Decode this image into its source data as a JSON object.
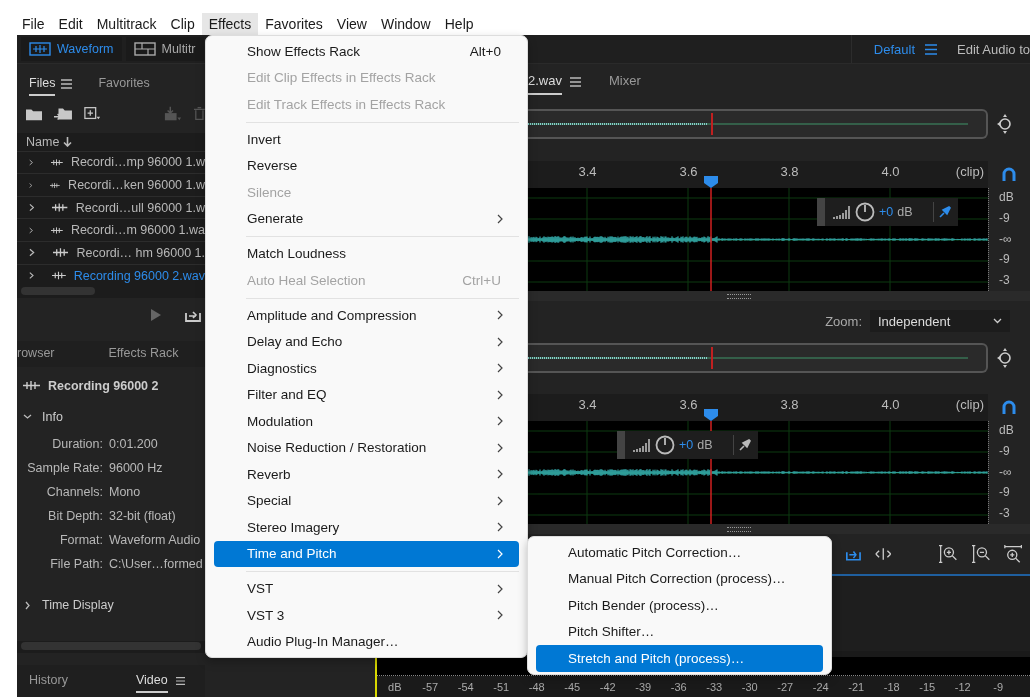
{
  "menu_bar": [
    {
      "label": "File",
      "selected": false
    },
    {
      "label": "Edit",
      "selected": false
    },
    {
      "label": "Multitrack",
      "selected": false
    },
    {
      "label": "Clip",
      "selected": false
    },
    {
      "label": "Effects",
      "selected": true
    },
    {
      "label": "Favorites",
      "selected": false
    },
    {
      "label": "View",
      "selected": false
    },
    {
      "label": "Window",
      "selected": false
    },
    {
      "label": "Help",
      "selected": false
    }
  ],
  "toolbar": {
    "modes": [
      {
        "label": "Waveform",
        "selected": true
      },
      {
        "label": "Multitr",
        "selected": false
      }
    ],
    "workspace": "Default",
    "next_workspace": "Edit Audio to"
  },
  "files_panel": {
    "tabs": [
      {
        "label": "Files",
        "selected": true
      },
      {
        "label": "Favorites",
        "selected": false
      }
    ],
    "column": "Name",
    "files": [
      {
        "name": "Recordi…mp 96000 1.w",
        "selected": false
      },
      {
        "name": "Recordi…ken 96000 1.w",
        "selected": false
      },
      {
        "name": "Recordi…ull 96000 1.w",
        "selected": false
      },
      {
        "name": "Recordi…m 96000 1.wa",
        "selected": false
      },
      {
        "name": "Recordi… hm 96000 1.",
        "selected": false
      },
      {
        "name": "Recording 96000 2.wav",
        "selected": true
      }
    ]
  },
  "properties_panel": {
    "tabs": [
      {
        "label": "rowser",
        "selected": false
      },
      {
        "label": "Effects Rack",
        "selected": false
      }
    ],
    "file": "Recording 96000 2",
    "sections": [
      {
        "title": "Info",
        "expanded": true,
        "rows": [
          {
            "label": "Duration:",
            "value": "0:01.200"
          },
          {
            "label": "Sample Rate:",
            "value": "96000 Hz"
          },
          {
            "label": "Channels:",
            "value": "Mono"
          },
          {
            "label": "Bit Depth:",
            "value": "32-bit (float)"
          },
          {
            "label": "Format:",
            "value": "Waveform Audio"
          },
          {
            "label": "File Path:",
            "value": "C:\\User…formed"
          }
        ]
      },
      {
        "title": "Time Display",
        "expanded": false
      }
    ]
  },
  "bottom_tabs": [
    {
      "label": "History",
      "selected": false
    },
    {
      "label": "Video",
      "selected": true
    }
  ],
  "editor": {
    "tabs": [
      {
        "label": "2.wav",
        "selected": true
      },
      {
        "label": "Mixer",
        "selected": false
      }
    ],
    "zoom_label": "Zoom:",
    "zoom_value": "Independent",
    "tracks": [
      {
        "ruler": [
          "3.4",
          "3.6",
          "3.8",
          "4.0"
        ],
        "ruler_end": "(clip)",
        "gain": "+0",
        "gain_unit": "dB",
        "scale": [
          "dB",
          "-9",
          "-∞",
          "-9",
          "-3"
        ]
      },
      {
        "ruler": [
          "3.4",
          "3.6",
          "3.8",
          "4.0"
        ],
        "ruler_end": "(clip)",
        "gain": "+0",
        "gain_unit": "dB",
        "scale": [
          "dB",
          "-9",
          "-∞",
          "-9",
          "-3"
        ]
      }
    ]
  },
  "meter": {
    "labels": [
      "dB",
      "-57",
      "-54",
      "-51",
      "-48",
      "-45",
      "-42",
      "-39",
      "-36",
      "-33",
      "-30",
      "-27",
      "-24",
      "-21",
      "-18",
      "-15",
      "-12",
      "-9"
    ]
  },
  "effects_menu": [
    {
      "kind": "item",
      "label": "Show Effects Rack",
      "shortcut": "Alt+0",
      "disabled": false,
      "submenu": false,
      "selected": false
    },
    {
      "kind": "item",
      "label": "Edit Clip Effects in Effects Rack",
      "disabled": true,
      "submenu": false,
      "selected": false
    },
    {
      "kind": "item",
      "label": "Edit Track Effects in Effects Rack",
      "disabled": true,
      "submenu": false,
      "selected": false
    },
    {
      "kind": "separator"
    },
    {
      "kind": "item",
      "label": "Invert",
      "disabled": false,
      "submenu": false,
      "selected": false
    },
    {
      "kind": "item",
      "label": "Reverse",
      "disabled": false,
      "submenu": false,
      "selected": false
    },
    {
      "kind": "item",
      "label": "Silence",
      "disabled": true,
      "submenu": false,
      "selected": false
    },
    {
      "kind": "item",
      "label": "Generate",
      "disabled": false,
      "submenu": true,
      "selected": false
    },
    {
      "kind": "separator"
    },
    {
      "kind": "item",
      "label": "Match Loudness",
      "disabled": false,
      "submenu": false,
      "selected": false
    },
    {
      "kind": "item",
      "label": "Auto Heal Selection",
      "shortcut": "Ctrl+U",
      "disabled": true,
      "submenu": false,
      "selected": false
    },
    {
      "kind": "separator"
    },
    {
      "kind": "item",
      "label": "Amplitude and Compression",
      "disabled": false,
      "submenu": true,
      "selected": false
    },
    {
      "kind": "item",
      "label": "Delay and Echo",
      "disabled": false,
      "submenu": true,
      "selected": false
    },
    {
      "kind": "item",
      "label": "Diagnostics",
      "disabled": false,
      "submenu": true,
      "selected": false
    },
    {
      "kind": "item",
      "label": "Filter and EQ",
      "disabled": false,
      "submenu": true,
      "selected": false
    },
    {
      "kind": "item",
      "label": "Modulation",
      "disabled": false,
      "submenu": true,
      "selected": false
    },
    {
      "kind": "item",
      "label": "Noise Reduction / Restoration",
      "disabled": false,
      "submenu": true,
      "selected": false
    },
    {
      "kind": "item",
      "label": "Reverb",
      "disabled": false,
      "submenu": true,
      "selected": false
    },
    {
      "kind": "item",
      "label": "Special",
      "disabled": false,
      "submenu": true,
      "selected": false
    },
    {
      "kind": "item",
      "label": "Stereo Imagery",
      "disabled": false,
      "submenu": true,
      "selected": false
    },
    {
      "kind": "item",
      "label": "Time and Pitch",
      "disabled": false,
      "submenu": true,
      "selected": true
    },
    {
      "kind": "separator"
    },
    {
      "kind": "item",
      "label": "VST",
      "disabled": false,
      "submenu": true,
      "selected": false
    },
    {
      "kind": "item",
      "label": "VST 3",
      "disabled": false,
      "submenu": true,
      "selected": false
    },
    {
      "kind": "item",
      "label": "Audio Plug-In Manager…",
      "disabled": false,
      "submenu": false,
      "selected": false
    }
  ],
  "time_and_pitch_menu": [
    {
      "label": "Automatic Pitch Correction…",
      "selected": false
    },
    {
      "label": "Manual Pitch Correction (process)…",
      "selected": false
    },
    {
      "label": "Pitch Bender (process)…",
      "selected": false
    },
    {
      "label": "Pitch Shifter…",
      "selected": false
    },
    {
      "label": "Stretch and Pitch (process)…",
      "selected": true
    }
  ]
}
